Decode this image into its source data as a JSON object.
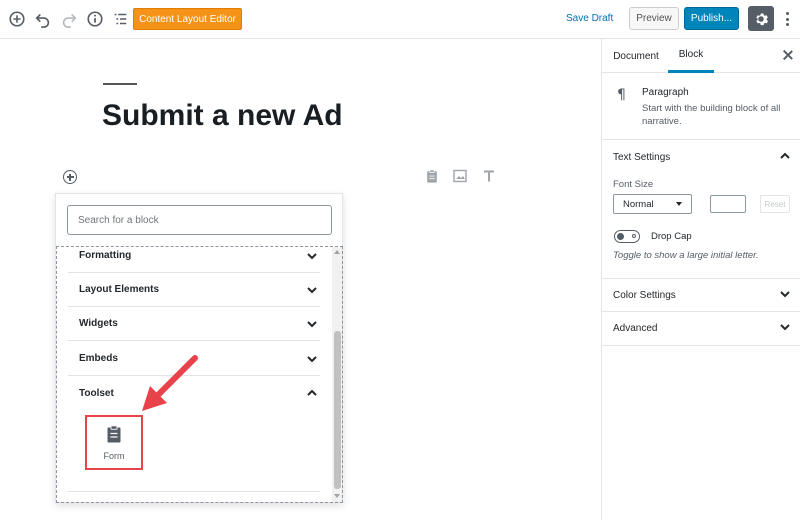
{
  "toolbar": {
    "content_layout_editor_label": "Content Layout Editor",
    "save_draft_label": "Save Draft",
    "preview_label": "Preview",
    "publish_label": "Publish..."
  },
  "editor": {
    "post_title": "Submit a new Ad"
  },
  "inserter": {
    "search_placeholder": "Search for a block",
    "categories": [
      {
        "label": "Formatting",
        "expanded": false
      },
      {
        "label": "Layout Elements",
        "expanded": false
      },
      {
        "label": "Widgets",
        "expanded": false
      },
      {
        "label": "Embeds",
        "expanded": false
      },
      {
        "label": "Toolset",
        "expanded": true
      }
    ],
    "toolset_blocks": [
      {
        "label": "Form",
        "icon": "clipboard-icon"
      }
    ]
  },
  "sidebar": {
    "tabs": [
      "Document",
      "Block"
    ],
    "active_tab": "Block",
    "block_card": {
      "title": "Paragraph",
      "description": "Start with the building block of all narrative.",
      "icon": "paragraph-icon"
    },
    "text_settings": {
      "title": "Text Settings",
      "font_size_label": "Font Size",
      "font_size_value": "Normal",
      "reset_label": "Reset",
      "drop_cap_label": "Drop Cap",
      "drop_cap_help": "Toggle to show a large initial letter."
    },
    "color_settings_title": "Color Settings",
    "advanced_title": "Advanced"
  },
  "colors": {
    "accent": "#0085ba",
    "orange_button": "#f59318",
    "highlight_red": "#e8424b"
  }
}
